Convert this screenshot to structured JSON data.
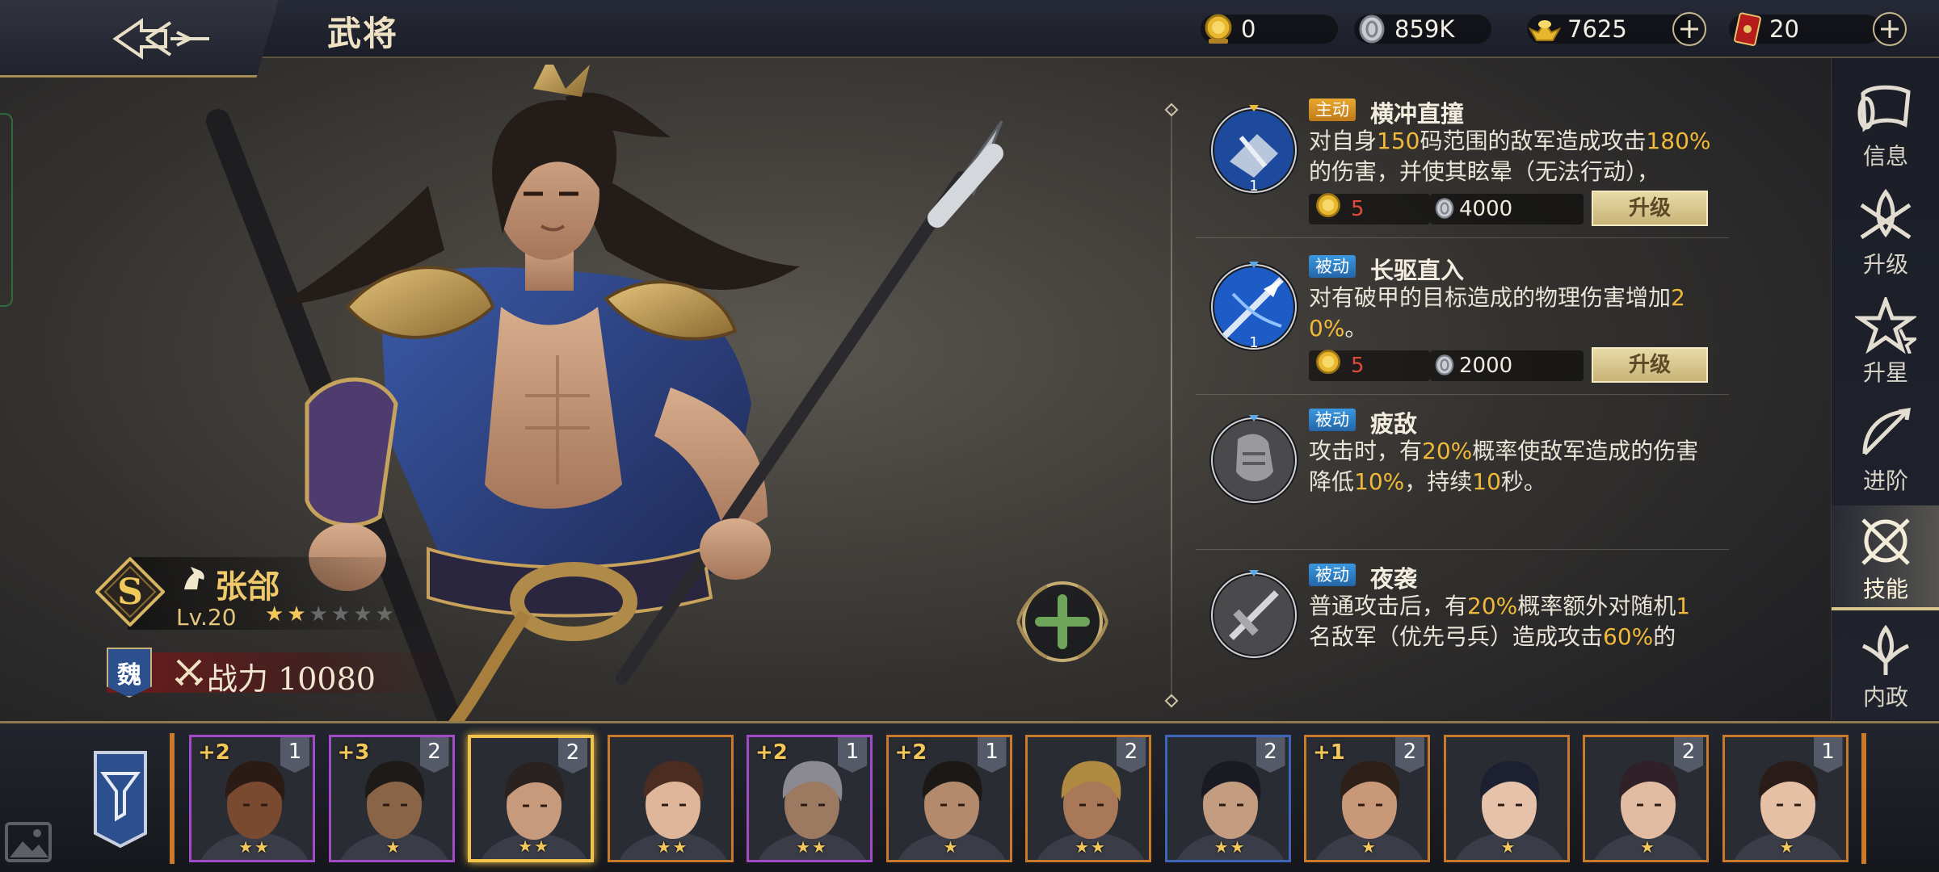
{
  "header": {
    "title": "武将",
    "resources": [
      {
        "name": "gold-coin",
        "value": "0"
      },
      {
        "name": "silver",
        "value": "859K"
      },
      {
        "name": "gold-ingot",
        "value": "7625"
      },
      {
        "name": "red-ticket",
        "value": "20"
      }
    ]
  },
  "hero": {
    "rank": "S",
    "name": "张郃",
    "level": "Lv.20",
    "stars_total": 6,
    "stars_filled": 2,
    "faction": "魏",
    "power": "战力 10080"
  },
  "skills": [
    {
      "type": "主动",
      "type_kind": "active",
      "name": "横冲直撞",
      "level": "1",
      "desc_parts": [
        {
          "t": "对自身"
        },
        {
          "t": "150",
          "hl": true
        },
        {
          "t": "码范围的敌军造成攻击"
        },
        {
          "t": "180%",
          "hl": true
        },
        {
          "t": "的伤害，并使其眩晕（无法行动），"
        }
      ],
      "cost_coin": "5",
      "cost_silver": "4000",
      "upgrade_label": "升级"
    },
    {
      "type": "被动",
      "type_kind": "passive",
      "name": "长驱直入",
      "level": "1",
      "desc_parts": [
        {
          "t": "对有破甲的目标造成的物理伤害增加"
        },
        {
          "t": "20%",
          "hl": true
        },
        {
          "t": "。"
        }
      ],
      "cost_coin": "5",
      "cost_silver": "2000",
      "upgrade_label": "升级"
    },
    {
      "type": "被动",
      "type_kind": "passive",
      "name": "疲敌",
      "level": "",
      "desc_parts": [
        {
          "t": "攻击时，有"
        },
        {
          "t": "20%",
          "hl": true
        },
        {
          "t": "概率使敌军造成的伤害降低"
        },
        {
          "t": "10%",
          "hl": true
        },
        {
          "t": "，持续"
        },
        {
          "t": "10",
          "hl": true
        },
        {
          "t": "秒。"
        }
      ]
    },
    {
      "type": "被动",
      "type_kind": "passive",
      "name": "夜袭",
      "level": "",
      "desc_parts": [
        {
          "t": "普通攻击后，有"
        },
        {
          "t": "20%",
          "hl": true
        },
        {
          "t": "概率额外对随机"
        },
        {
          "t": "1",
          "hl": true
        },
        {
          "t": "名敌军（优先弓兵）造成攻击"
        },
        {
          "t": "60%",
          "hl": true
        },
        {
          "t": "的"
        }
      ]
    }
  ],
  "nav": [
    {
      "label": "信息",
      "icon": "scroll-icon"
    },
    {
      "label": "升级",
      "icon": "crossed-swords-icon"
    },
    {
      "label": "升星",
      "icon": "star-icon"
    },
    {
      "label": "进阶",
      "icon": "bow-arrow-icon"
    },
    {
      "label": "技能",
      "icon": "skill-crossed-blades-icon",
      "active": true
    },
    {
      "label": "内政",
      "icon": "lotus-icon"
    }
  ],
  "roster": [
    {
      "plus": "+2",
      "count": "1",
      "stars": "★★",
      "quality": "purple",
      "skin": "#7a4a30",
      "hair": "#2a1c14"
    },
    {
      "plus": "+3",
      "count": "2",
      "stars": "★",
      "quality": "purple",
      "skin": "#8a6446",
      "hair": "#1e1a18"
    },
    {
      "plus": "",
      "count": "2",
      "stars": "★★",
      "quality": "orange",
      "skin": "#c79a7c",
      "hair": "#2a2220",
      "selected": true
    },
    {
      "plus": "",
      "count": "",
      "stars": "★★",
      "quality": "orange",
      "skin": "#e0b69a",
      "hair": "#4a2c20"
    },
    {
      "plus": "+2",
      "count": "1",
      "stars": "★★",
      "quality": "purple",
      "skin": "#9c7a62",
      "hair": "#8a8a90"
    },
    {
      "plus": "+2",
      "count": "1",
      "stars": "★",
      "quality": "orange",
      "skin": "#b48a6c",
      "hair": "#1c1816"
    },
    {
      "plus": "",
      "count": "2",
      "stars": "★★",
      "quality": "orange",
      "skin": "#a87858",
      "hair": "#b08a40"
    },
    {
      "plus": "",
      "count": "2",
      "stars": "★★",
      "quality": "blue",
      "skin": "#c49c80",
      "hair": "#1a1a22"
    },
    {
      "plus": "+1",
      "count": "2",
      "stars": "★",
      "quality": "orange",
      "skin": "#c89878",
      "hair": "#2c2018"
    },
    {
      "plus": "",
      "count": "",
      "stars": "★",
      "quality": "orange",
      "skin": "#e6c2aa",
      "hair": "#1c2030"
    },
    {
      "plus": "",
      "count": "2",
      "stars": "★",
      "quality": "orange",
      "skin": "#e2bca2",
      "hair": "#302028"
    },
    {
      "plus": "",
      "count": "1",
      "stars": "★",
      "quality": "orange",
      "skin": "#e6c0a4",
      "hair": "#2a1c18"
    }
  ],
  "colors": {
    "accent_gold": "#f0b939",
    "active_type": "#e9a830",
    "passive_type": "#3a98e0",
    "power_red": "#781919"
  }
}
